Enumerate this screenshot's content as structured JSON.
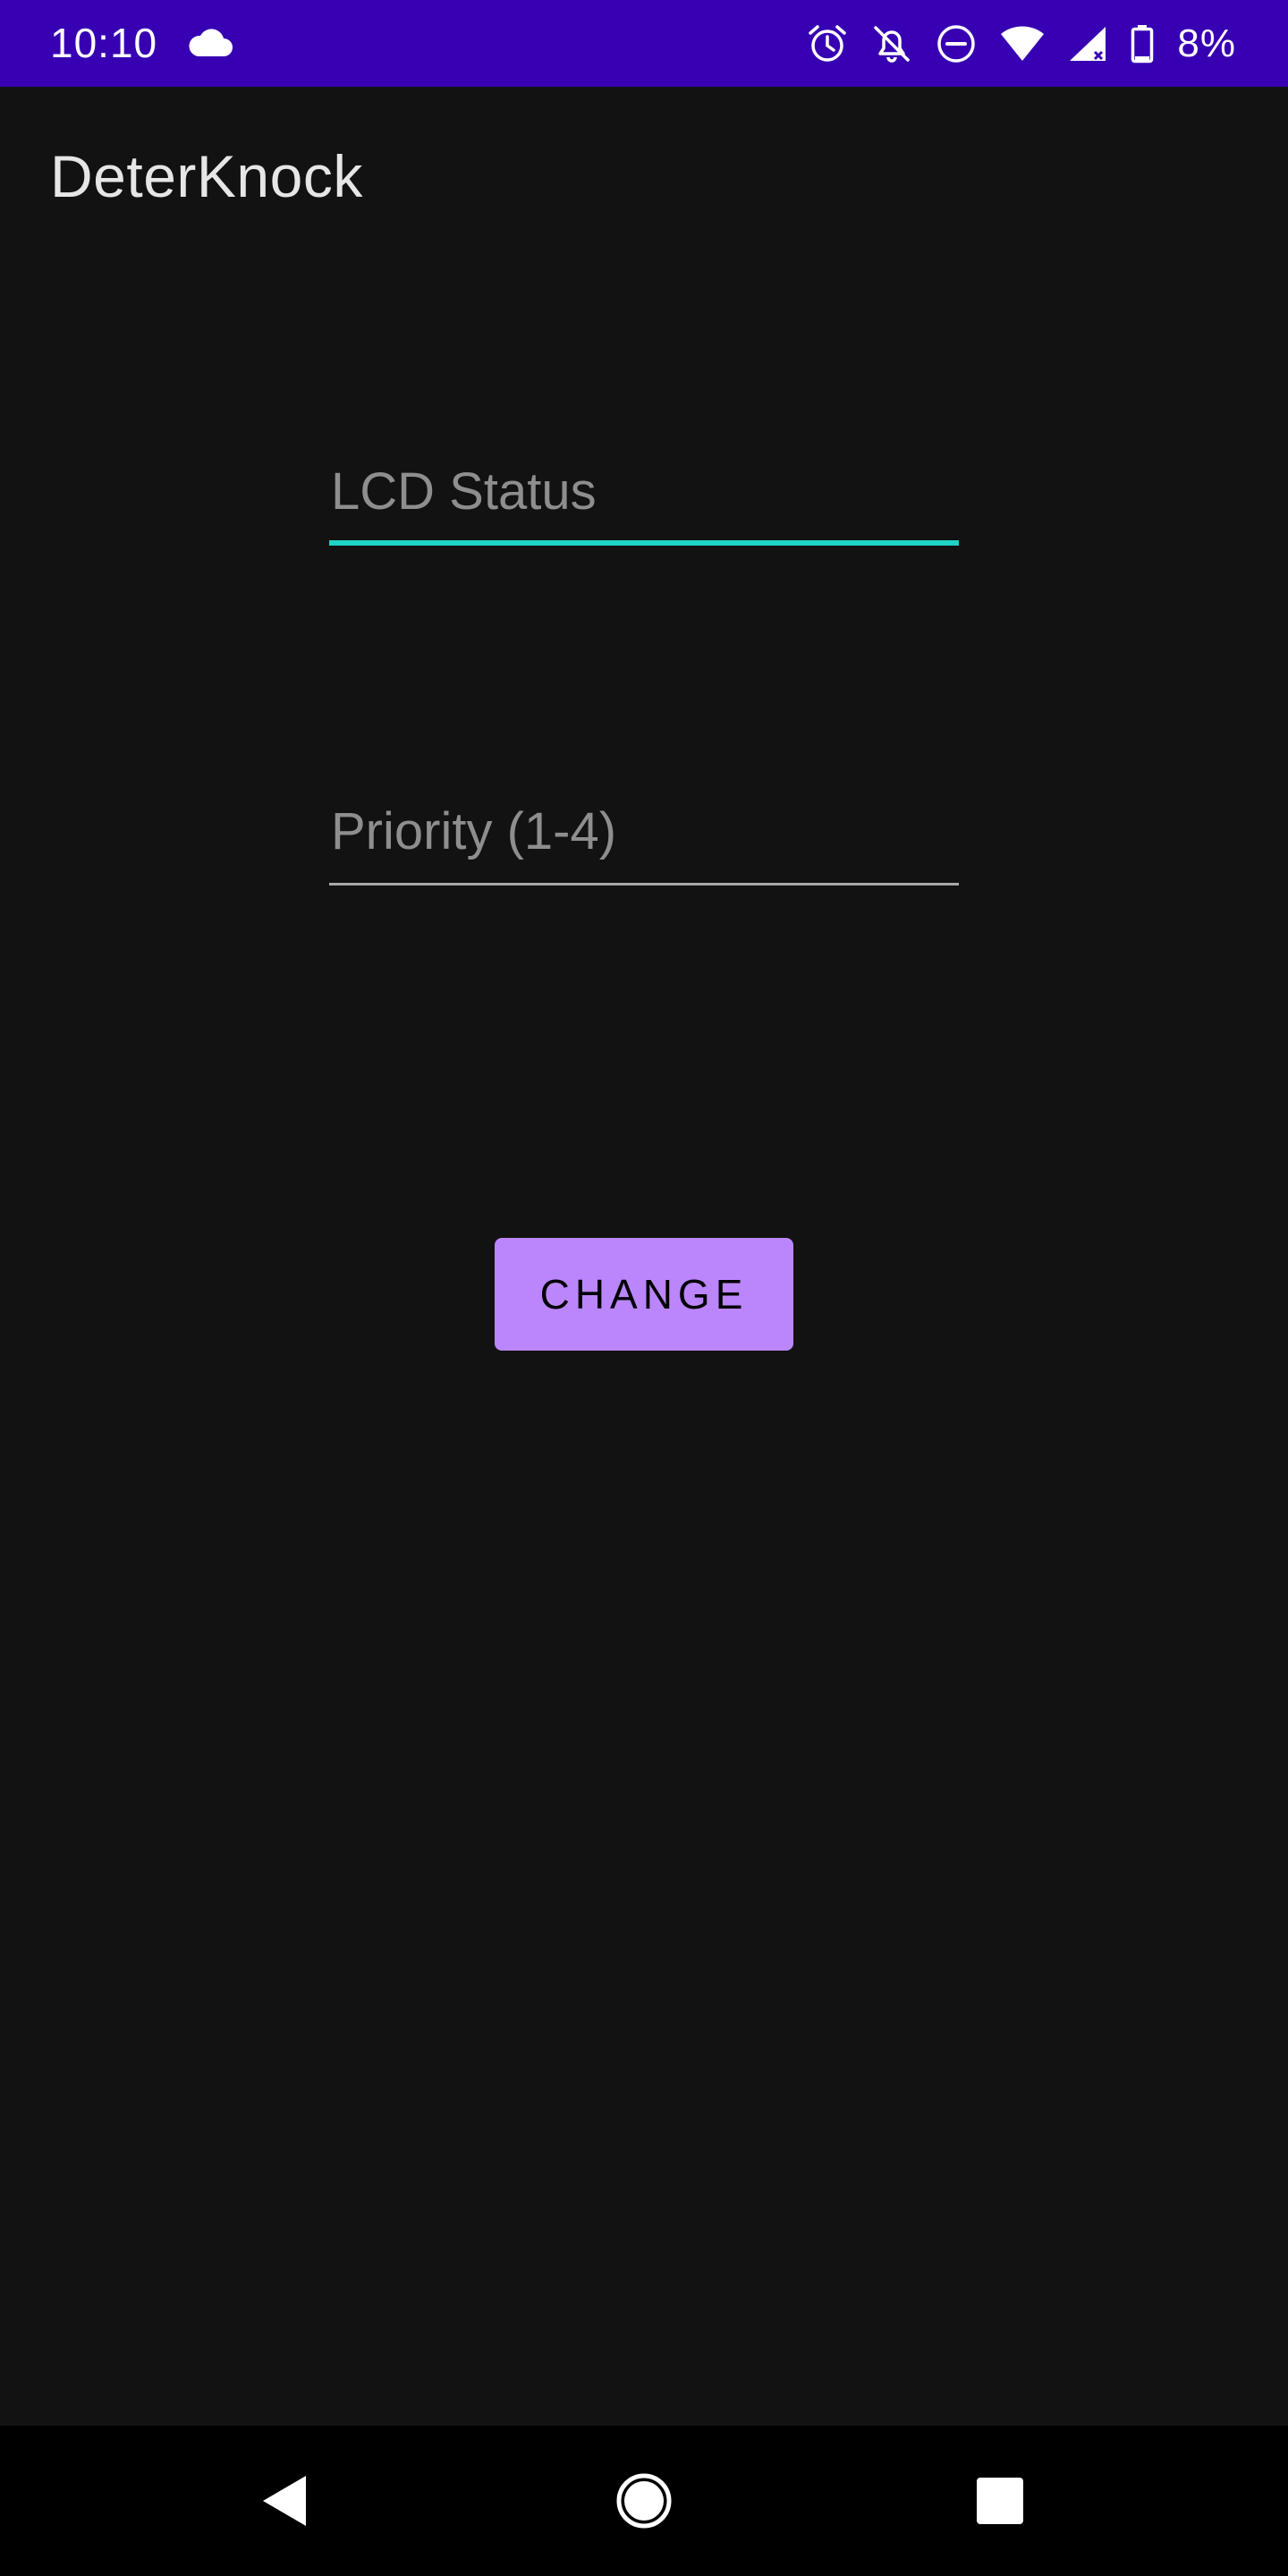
{
  "status_bar": {
    "time": "10:10",
    "battery_percent": "8%",
    "background_color": "#3700b3",
    "icons": [
      "cloud-icon",
      "alarm-icon",
      "notifications-off-icon",
      "do-not-disturb-icon",
      "wifi-icon",
      "signal-icon",
      "battery-icon"
    ]
  },
  "app_bar": {
    "title": "DeterKnock"
  },
  "form": {
    "lcd_status": {
      "value": "",
      "placeholder": "LCD Status",
      "focused": true,
      "underline_color": "#1fd3c6"
    },
    "priority": {
      "value": "",
      "placeholder": "Priority (1-4)",
      "focused": false,
      "underline_color": "#a8a8a8"
    },
    "change_button": {
      "label": "CHANGE",
      "color": "#bb86fc"
    }
  },
  "nav_bar": {
    "icons": [
      "back-icon",
      "home-icon",
      "recents-icon"
    ]
  },
  "theme": {
    "background": "#121212"
  }
}
